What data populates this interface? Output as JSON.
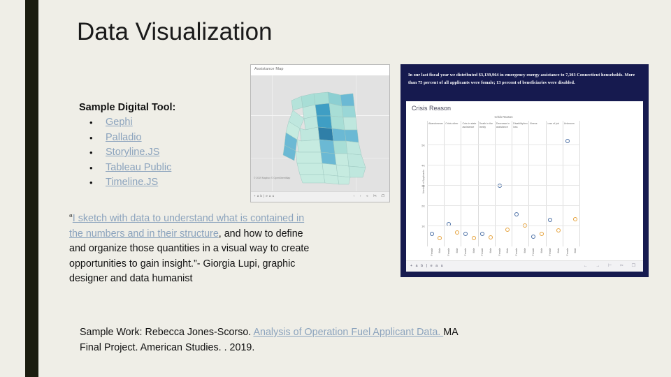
{
  "slide": {
    "title": "Data Visualization",
    "accent_color": "#1b1d10",
    "background_color": "#efeee7",
    "link_color": "#8ba3bd"
  },
  "tools": {
    "heading": "Sample Digital Tool:",
    "bullet_glyph": "•",
    "items": [
      {
        "label": "Gephi"
      },
      {
        "label": "Palladio"
      },
      {
        "label": "Storyline.JS"
      },
      {
        "label": "Tableau Public"
      },
      {
        "label": "Timeline.JS"
      }
    ]
  },
  "quote": {
    "open_mark": "“",
    "linked_part": "I sketch with data to understand what is contained in the numbers and in their structure",
    "rest": ", and how to define and organize those quantities in a visual way to create opportunities to gain insight.”- Giorgia Lupi, graphic designer and data humanist"
  },
  "citation": {
    "prefix": "Sample Work: Rebecca Jones-Scorso. ",
    "linked_part": "Analysis of Operation Fuel Applicant Data. ",
    "suffix": "MA Final Project. American Studies. . 2019."
  },
  "map_embed": {
    "title": "Assistance Map",
    "attribution": "© 2019 Mapbox © OpenStreetMap",
    "toolbar_brand": "+ a b | e a u",
    "toolbar_icons": "‹ › ⫷ ✂ ❐"
  },
  "dashboard": {
    "panel_color": "#161a4f",
    "note": "In our last fiscal year we distributed $3,139,964 in emergency energy assistance to 7,303 Connecticut households. More than 75 percent of all applicants were female; 13 percent of beneficiaries were disabled.",
    "viz_title": "Crisis Reason",
    "toolbar_brand": "+ a b | e a u",
    "toolbar_icons": "← → ⊢ ✂ ❐"
  },
  "chart_data": {
    "type": "scatter",
    "title": "Crisis Reason",
    "header_label": "Crisis Reason",
    "xlabel": "",
    "ylabel": "Number of Applicants",
    "ylim": [
      0,
      5500
    ],
    "yticks": [
      "1K",
      "2K",
      "3K",
      "4K",
      "5K"
    ],
    "ytick_values": [
      1000,
      2000,
      3000,
      4000,
      5000
    ],
    "grid": true,
    "legend": "none",
    "subcategories": [
      "Female",
      "Male"
    ],
    "categories": [
      "Abandonment/crime",
      "Crisis other",
      "Cuts in state assistance",
      "Death in the family",
      "Decrease in assistance",
      "Disability/income loss",
      "Illness",
      "Loss of job",
      "Unknown"
    ],
    "series": [
      {
        "name": "Female",
        "color": "#4a6fa5",
        "values": [
          620,
          1090,
          620,
          610,
          600,
          1580,
          480,
          1300,
          480
        ]
      },
      {
        "name": "Male",
        "color": "#e5a13a",
        "values": [
          400,
          680,
          420,
          450,
          820,
          1020,
          620,
          780,
          1350
        ]
      }
    ],
    "outliers": [
      {
        "category": "Decrease in assistance",
        "subcategory": "Female",
        "value": 2980,
        "color": "#4a6fa5"
      },
      {
        "category": "Unknown",
        "subcategory": "Female",
        "value": 5200,
        "color": "#4a6fa5"
      }
    ]
  }
}
